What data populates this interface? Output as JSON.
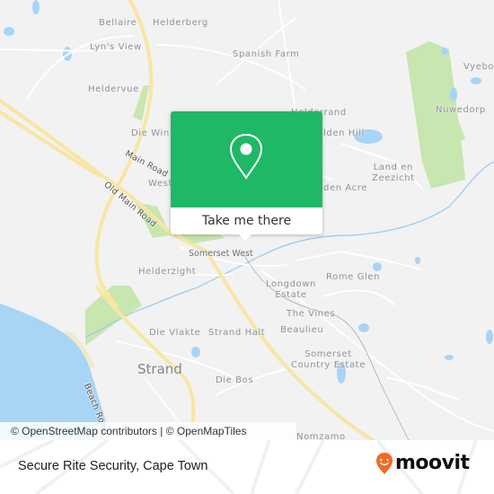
{
  "map": {
    "places": [
      {
        "id": "bellaire",
        "label": "Bellaire"
      },
      {
        "id": "helderberg",
        "label": "Helderberg"
      },
      {
        "id": "lyns-view",
        "label": "Lyn's View"
      },
      {
        "id": "spanish-farm",
        "label": "Spanish Farm"
      },
      {
        "id": "heldervue",
        "label": "Heldervue"
      },
      {
        "id": "vyeboom",
        "label": "Vyebo"
      },
      {
        "id": "nuwedorp",
        "label": "Nuwedorp"
      },
      {
        "id": "helderrand",
        "label": "Helderrand"
      },
      {
        "id": "golden-hill",
        "label": "lden Hill"
      },
      {
        "id": "die-wingerd",
        "label": "Die Win"
      },
      {
        "id": "west",
        "label": "West"
      },
      {
        "id": "land-en-zeezicht",
        "label": "Land en\nZeezicht"
      },
      {
        "id": "golden-acre",
        "label": "den Acre"
      },
      {
        "id": "somerset-west",
        "label": "Somerset West"
      },
      {
        "id": "helderzight",
        "label": "Helderzight"
      },
      {
        "id": "rome-glen",
        "label": "Rome Glen"
      },
      {
        "id": "longdown-estate",
        "label": "Longdown\nEstate"
      },
      {
        "id": "the-vines",
        "label": "The Vines"
      },
      {
        "id": "die-vlakte",
        "label": "Die Vlakte"
      },
      {
        "id": "strand-halt",
        "label": "Strand Halt"
      },
      {
        "id": "beaulieu",
        "label": "Beaulieu"
      },
      {
        "id": "somerset-country-estate",
        "label": "Somerset\nCountry Estate"
      },
      {
        "id": "strand",
        "label": "Strand"
      },
      {
        "id": "die-bos",
        "label": "Die Bos"
      },
      {
        "id": "nomzamo",
        "label": "Nomzamo"
      }
    ],
    "roads": {
      "main_road": "Main Road",
      "old_main_road": "Old Main Road",
      "beach_road": "Beach Road"
    },
    "attribution": "© OpenStreetMap contributors | © OpenMapTiles",
    "colors": {
      "land": "#f2f2f2",
      "water": "#a8d4f5",
      "park": "#c8e6b0",
      "major_road": "#f7e6a3",
      "accent": "#1fb866"
    }
  },
  "popup": {
    "icon": "map-pin-icon",
    "cta_label": "Take me there"
  },
  "footer": {
    "title": "Secure Rite Security, Cape Town",
    "logo_text": "moovit",
    "logo_icon": "moovit-pin-smile-icon",
    "logo_color": "#f26a22"
  }
}
